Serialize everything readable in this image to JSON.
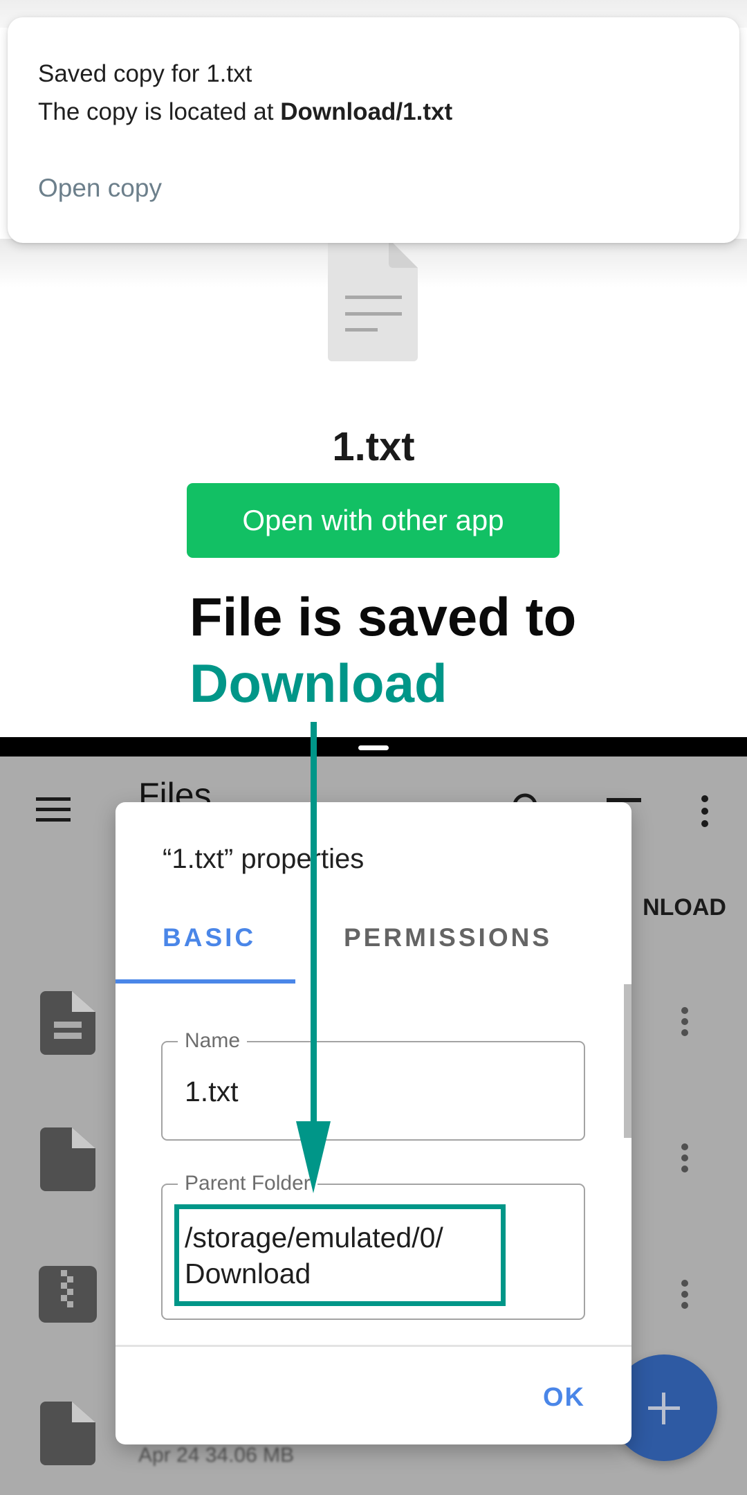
{
  "snackbar": {
    "title": "Saved copy for 1.txt",
    "body_prefix": "The copy is located at ",
    "body_path": "Download/1.txt",
    "action_label": "Open copy"
  },
  "viewer": {
    "file_icon": "text-file-icon",
    "file_name": "1.txt",
    "open_with_label": "Open with other app",
    "button_color": "#12c064"
  },
  "annotation": {
    "line1": "File is saved to",
    "line2": "Download",
    "accent_color": "#009688"
  },
  "files_app": {
    "title": "Files",
    "breadcrumb_partial": "NLOAD",
    "toolbar_icons": [
      "menu-icon",
      "search-icon",
      "sort-icon",
      "more-vert-icon"
    ],
    "list_icons": [
      "text-file-icon",
      "generic-file-icon",
      "archive-file-icon",
      "generic-file-icon"
    ],
    "last_item_meta": "Apr 24   34.06 MB",
    "fab_icon": "plus-icon"
  },
  "dialog": {
    "title": "“1.txt” properties",
    "tabs": [
      {
        "label": "BASIC",
        "active": true
      },
      {
        "label": "PERMISSIONS",
        "active": false
      }
    ],
    "fields": {
      "name": {
        "label": "Name",
        "value": "1.txt"
      },
      "parent": {
        "label": "Parent Folder",
        "value": "/storage/emulated/0/\nDownload"
      }
    },
    "ok_label": "OK",
    "accent_color": "#4a86e8"
  }
}
